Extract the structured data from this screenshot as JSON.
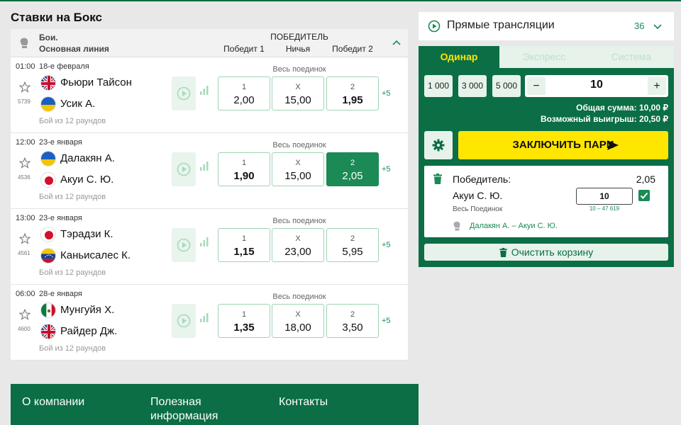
{
  "page": {
    "title": "Ставки на Бокс"
  },
  "events_header": {
    "category": "Бои.",
    "line": "Основная линия",
    "market_title": "ПОБЕДИТЕЛЬ",
    "col1": "Победит 1",
    "colx": "Ничья",
    "col2": "Победит 2"
  },
  "events": [
    {
      "time": "01:00",
      "date": "18-е февраля",
      "id": "5739",
      "p1": "Фьюри Тайсон",
      "p2": "Усик А.",
      "flag1": "uk",
      "flag2": "ukraine",
      "rounds": "Бой из 12 раундов",
      "market": "Весь поединок",
      "o1_label": "1",
      "o1": "2,00",
      "ox_label": "X",
      "ox": "15,00",
      "o2_label": "2",
      "o2": "1,95",
      "more": "+5"
    },
    {
      "time": "12:00",
      "date": "23-е января",
      "id": "4536",
      "p1": "Далакян А.",
      "p2": "Акуи С. Ю.",
      "flag1": "ukraine",
      "flag2": "japan",
      "rounds": "Бой из 12 раундов",
      "market": "Весь поединок",
      "o1_label": "1",
      "o1": "1,90",
      "ox_label": "X",
      "ox": "15,00",
      "o2_label": "2",
      "o2": "2,05",
      "more": "+5"
    },
    {
      "time": "13:00",
      "date": "23-е января",
      "id": "4561",
      "p1": "Тэрадзи К.",
      "p2": "Каньисалес К.",
      "flag1": "japan",
      "flag2": "venezuela",
      "rounds": "Бой из 12 раундов",
      "market": "Весь поединок",
      "o1_label": "1",
      "o1": "1,15",
      "ox_label": "X",
      "ox": "23,00",
      "o2_label": "2",
      "o2": "5,95",
      "more": "+5"
    },
    {
      "time": "06:00",
      "date": "28-е января",
      "id": "4600",
      "p1": "Мунгуйя Х.",
      "p2": "Райдер Дж.",
      "flag1": "mexico",
      "flag2": "uk",
      "rounds": "Бой из 12 раундов",
      "market": "Весь поединок",
      "o1_label": "1",
      "o1": "1,35",
      "ox_label": "X",
      "ox": "18,00",
      "o2_label": "2",
      "o2": "3,50",
      "more": "+5"
    }
  ],
  "footer": {
    "col1": "О компании",
    "col2": "Полезная информация",
    "col3": "Контакты"
  },
  "live": {
    "title": "Прямые трансляции",
    "count": "36"
  },
  "slip": {
    "tabs": [
      "Одинар",
      "Экспресс",
      "Система"
    ],
    "quick_stakes": [
      "1 000",
      "3 000",
      "5 000"
    ],
    "stake_value": "10",
    "total_label": "Общая сумма: 10,00 ₽",
    "winnings_label": "Возможный выигрыш: 20,50 ₽",
    "bet_button": "ЗАКЛЮЧИТЬ ПАРИ",
    "coupon": {
      "market": "Победитель:",
      "coef": "2,05",
      "pick": "Акуи С. Ю.",
      "sub": "Весь Поединок",
      "input_value": "10",
      "range": "10 – 47 619",
      "match": "Далакян А. – Акуи С. Ю."
    },
    "clear_button": "Очистить корзину"
  },
  "colors": {
    "brand": "#0b6e44",
    "accent": "#1b8a55",
    "yellow": "#ffe600"
  }
}
